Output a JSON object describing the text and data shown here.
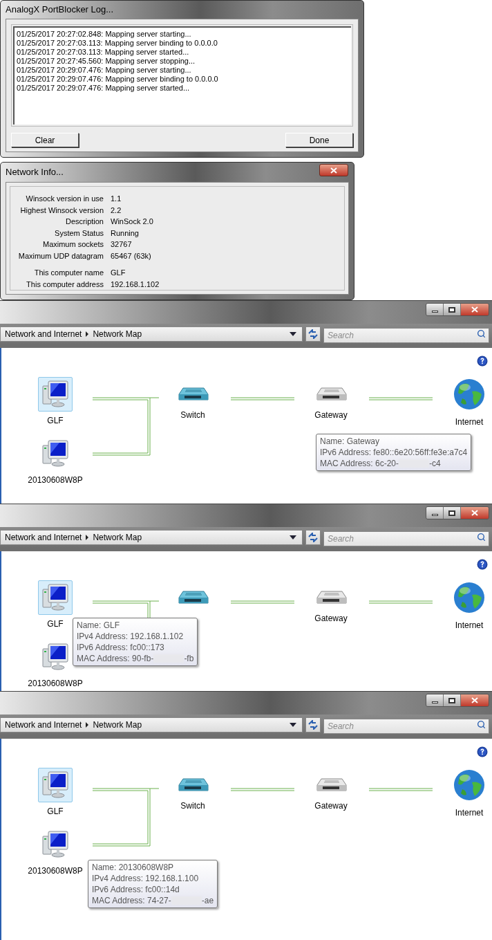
{
  "log_dialog": {
    "title": "AnalogX PortBlocker Log...",
    "log_lines": [
      "01/25/2017 20:27:02.848: Mapping server starting...",
      "01/25/2017 20:27:03.113: Mapping server binding to 0.0.0.0",
      "01/25/2017 20:27:03.113: Mapping server started...",
      "01/25/2017 20:27:45.560: Mapping server stopping...",
      "01/25/2017 20:29:07.476: Mapping server starting...",
      "01/25/2017 20:29:07.476: Mapping server binding to 0.0.0.0",
      "01/25/2017 20:29:07.476: Mapping server started..."
    ],
    "buttons": [
      "Clear",
      "Done"
    ]
  },
  "network_info": {
    "title": "Network Info...",
    "rows": [
      {
        "label": "Winsock version in use",
        "value": "1.1"
      },
      {
        "label": "Highest Winsock version",
        "value": "2.2"
      },
      {
        "label": "Description",
        "value": "WinSock 2.0"
      },
      {
        "label": "System Status",
        "value": "Running"
      },
      {
        "label": "Maximum sockets",
        "value": "32767"
      },
      {
        "label": "Maximum UDP datagram",
        "value": "65467 (63k)"
      }
    ],
    "computer_rows": [
      {
        "label": "This computer name",
        "value": "GLF"
      },
      {
        "label": "This computer address",
        "value": "192.168.1.102"
      }
    ]
  },
  "map_windows": [
    {
      "breadcrumb": [
        "Network and Internet",
        "Network Map"
      ],
      "search": {
        "placeholder": "Search"
      },
      "nodes": [
        {
          "kind": "computer",
          "label": "GLF",
          "selected": true
        },
        {
          "kind": "computer",
          "label": "20130608W8P",
          "selected": false
        },
        {
          "kind": "switch",
          "label": "Switch",
          "selected": false
        },
        {
          "kind": "gateway",
          "label": "Gateway",
          "selected": false,
          "tooltip": {
            "lines": [
              "Name: Gateway",
              "IPv6 Address: fe80::6e20:56ff:fe3e:a7c4"
            ],
            "mac": {
              "label": "MAC Address: 6c-20-",
              "end": "-c4"
            }
          }
        },
        {
          "kind": "internet",
          "label": "Internet",
          "selected": false
        }
      ]
    },
    {
      "breadcrumb": [
        "Network and Internet",
        "Network Map"
      ],
      "search": {
        "placeholder": "Search"
      },
      "nodes": [
        {
          "kind": "computer",
          "label": "GLF",
          "selected": true,
          "tooltip": {
            "lines": [
              "Name: GLF",
              "IPv4 Address: 192.168.1.102",
              "IPv6 Address: fc00::173"
            ],
            "mac": {
              "label": "MAC Address: 90-fb-",
              "end": "-fb"
            }
          }
        },
        {
          "kind": "computer",
          "label": "20130608W8P",
          "selected": false
        },
        {
          "kind": "switch",
          "selected": false
        },
        {
          "kind": "gateway",
          "label": "Gateway",
          "selected": false
        },
        {
          "kind": "internet",
          "label": "Internet",
          "selected": false
        }
      ]
    },
    {
      "breadcrumb": [
        "Network and Internet",
        "Network Map"
      ],
      "search": {
        "placeholder": "Search"
      },
      "nodes": [
        {
          "kind": "computer",
          "label": "GLF",
          "selected": true
        },
        {
          "kind": "computer",
          "label": "20130608W8P",
          "selected": false,
          "tooltip": {
            "lines": [
              "Name: 20130608W8P",
              "IPv4 Address: 192.168.1.100",
              "IPv6 Address: fc00::14d"
            ],
            "mac": {
              "label": "MAC Address: 74-27-",
              "end": "-ae"
            }
          }
        },
        {
          "kind": "switch",
          "label": "Switch",
          "selected": false
        },
        {
          "kind": "gateway",
          "label": "Gateway",
          "selected": false
        },
        {
          "kind": "internet",
          "label": "Internet",
          "selected": false
        }
      ]
    }
  ]
}
